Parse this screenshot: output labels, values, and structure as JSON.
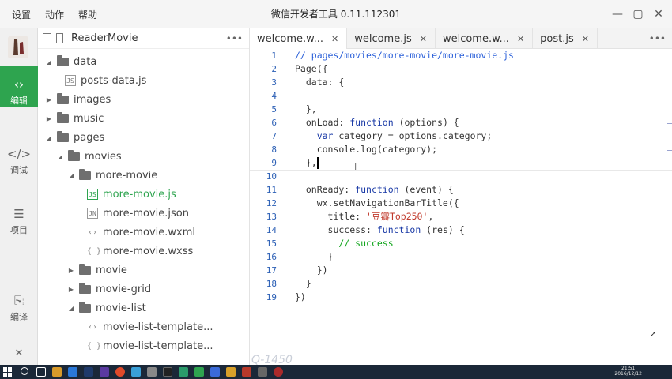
{
  "window": {
    "menu": [
      "设置",
      "动作",
      "帮助"
    ],
    "title": "微信开发者工具 0.11.112301",
    "controls": {
      "minimize": "—",
      "restore": "▢",
      "close": "✕"
    }
  },
  "activity": [
    {
      "label": "编辑",
      "icon": "code-icon",
      "glyph": "‹›",
      "active": true
    },
    {
      "label": "调试",
      "icon": "debug-icon",
      "glyph": "</>",
      "active": false
    },
    {
      "label": "项目",
      "icon": "project-icon",
      "glyph": "☰",
      "active": false
    },
    {
      "label": "编译",
      "icon": "compile-icon",
      "glyph": "⎘",
      "active": false
    }
  ],
  "activity_close": "✕",
  "explorer": {
    "project": "ReaderMovie",
    "more": "•••",
    "tree": [
      {
        "label": "data",
        "type": "folder",
        "depth": 0
      },
      {
        "label": "posts-data.js",
        "type": "js",
        "depth": 1
      },
      {
        "label": "images",
        "type": "folder-closed",
        "depth": 0
      },
      {
        "label": "music",
        "type": "folder-closed",
        "depth": 0
      },
      {
        "label": "pages",
        "type": "folder",
        "depth": 0
      },
      {
        "label": "movies",
        "type": "folder",
        "depth": 1
      },
      {
        "label": "more-movie",
        "type": "folder",
        "depth": 2
      },
      {
        "label": "more-movie.js",
        "type": "js",
        "depth": 3,
        "active": true
      },
      {
        "label": "more-movie.json",
        "type": "json",
        "depth": 3
      },
      {
        "label": "more-movie.wxml",
        "type": "wxml",
        "depth": 3
      },
      {
        "label": "more-movie.wxss",
        "type": "wxss",
        "depth": 3
      },
      {
        "label": "movie",
        "type": "folder-closed",
        "depth": 2
      },
      {
        "label": "movie-grid",
        "type": "folder-closed",
        "depth": 2
      },
      {
        "label": "movie-list",
        "type": "folder",
        "depth": 2
      },
      {
        "label": "movie-list-template...",
        "type": "wxml",
        "depth": 3
      },
      {
        "label": "movie-list-template...",
        "type": "wxss",
        "depth": 3
      }
    ]
  },
  "tabs": [
    {
      "label": "welcome.w...",
      "active": true
    },
    {
      "label": "welcome.js",
      "active": false
    },
    {
      "label": "welcome.w...",
      "active": false
    },
    {
      "label": "post.js",
      "active": false
    }
  ],
  "tabs_more": "•••",
  "editor": {
    "lines": [
      [
        {
          "t": "// pages/movies/more-movie/more-movie.js",
          "c": "cm"
        }
      ],
      [
        {
          "t": "Page({",
          "c": ""
        }
      ],
      [
        {
          "t": "  data: {",
          "c": ""
        }
      ],
      [
        {
          "t": "",
          "c": ""
        }
      ],
      [
        {
          "t": "  },",
          "c": ""
        }
      ],
      [
        {
          "t": "  onLoad: ",
          "c": ""
        },
        {
          "t": "function",
          "c": "kw"
        },
        {
          "t": " (options) {",
          "c": ""
        }
      ],
      [
        {
          "t": "    ",
          "c": ""
        },
        {
          "t": "var",
          "c": "kw"
        },
        {
          "t": " category = options.category;",
          "c": ""
        }
      ],
      [
        {
          "t": "    console.log(category);",
          "c": ""
        }
      ],
      [
        {
          "t": "  },",
          "c": ""
        }
      ],
      [
        {
          "t": "",
          "c": ""
        }
      ],
      [
        {
          "t": "  onReady: ",
          "c": ""
        },
        {
          "t": "function",
          "c": "kw"
        },
        {
          "t": " (event) {",
          "c": ""
        }
      ],
      [
        {
          "t": "    wx.setNavigationBarTitle({",
          "c": ""
        }
      ],
      [
        {
          "t": "      title: ",
          "c": ""
        },
        {
          "t": "'豆瓣Top250'",
          "c": "str"
        },
        {
          "t": ",",
          "c": ""
        }
      ],
      [
        {
          "t": "      success: ",
          "c": ""
        },
        {
          "t": "function",
          "c": "kw"
        },
        {
          "t": " (res) {",
          "c": ""
        }
      ],
      [
        {
          "t": "        // success",
          "c": "ok"
        }
      ],
      [
        {
          "t": "      }",
          "c": ""
        }
      ],
      [
        {
          "t": "    })",
          "c": ""
        }
      ],
      [
        {
          "t": "  }",
          "c": ""
        }
      ],
      [
        {
          "t": "})",
          "c": ""
        }
      ]
    ],
    "cursor_line": 9
  },
  "taskbar": {
    "time": "21:51",
    "date": "2016/12/12",
    "ghost_text": "Q-1450"
  },
  "colors": {
    "accent_green": "#2ea44f",
    "line_number_blue": "#2b5fb5",
    "keyword_blue": "#1a3aa6",
    "string_red": "#c0392b",
    "comment_green": "#12a51d"
  }
}
